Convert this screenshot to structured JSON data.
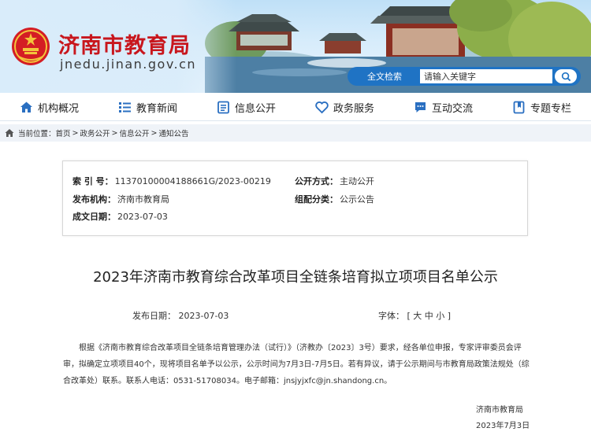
{
  "header": {
    "site_title": "济南市教育局",
    "site_url": "jnedu.jinan.gov.cn",
    "search_label": "全文检索",
    "search_placeholder": "请输入关键字"
  },
  "nav": {
    "items": [
      {
        "label": "机构概况",
        "icon": "home-icon"
      },
      {
        "label": "教育新闻",
        "icon": "list-icon"
      },
      {
        "label": "信息公开",
        "icon": "document-icon"
      },
      {
        "label": "政务服务",
        "icon": "heart-icon"
      },
      {
        "label": "互动交流",
        "icon": "chat-icon"
      },
      {
        "label": "专题专栏",
        "icon": "bookmark-icon"
      }
    ]
  },
  "breadcrumb": {
    "prefix": "当前位置：",
    "items": [
      "首页",
      "政务公开",
      "信息公开",
      "通知公告"
    ]
  },
  "info": {
    "index_key": "索 引 号：",
    "index_val": "11370100004188661G/2023-00219",
    "open_key": "公开方式：",
    "open_val": "主动公开",
    "org_key": "发布机构：",
    "org_val": "济南市教育局",
    "category_key": "组配分类：",
    "category_val": "公示公告",
    "date_key": "成文日期：",
    "date_val": "2023-07-03"
  },
  "doc": {
    "title": "2023年济南市教育综合改革项目全链条培育拟立项项目名单公示",
    "publish_label": "发布日期：",
    "publish_date": "2023-07-03",
    "font_label": "字体：",
    "font_open": "[",
    "font_large": "大",
    "font_medium": "中",
    "font_small": "小",
    "font_close": "]",
    "body_line1": "根据《济南市教育综合改革项目全链条培育管理办法（试行）》（济教办〔2023〕3号）要求，经各单位申报，专家评审",
    "body_line2": "委员会评审，拟确定立项项目40个，现将项目名单予以公示，公示时间为7月3日-7月5日。若有异议，请于公示期间与市教育",
    "body_line3": "局政策法规处（综合改革处）联系。联系人电话：0531-51708034。电子邮箱：jnsjyjxfc@jn.shandong.cn。",
    "sign_org": "济南市教育局",
    "sign_date": "2023年7月3日"
  },
  "colors": {
    "brand_red": "#c8161d",
    "search_blue": "#1f73c4",
    "nav_icon_blue": "#2a6fc1"
  }
}
